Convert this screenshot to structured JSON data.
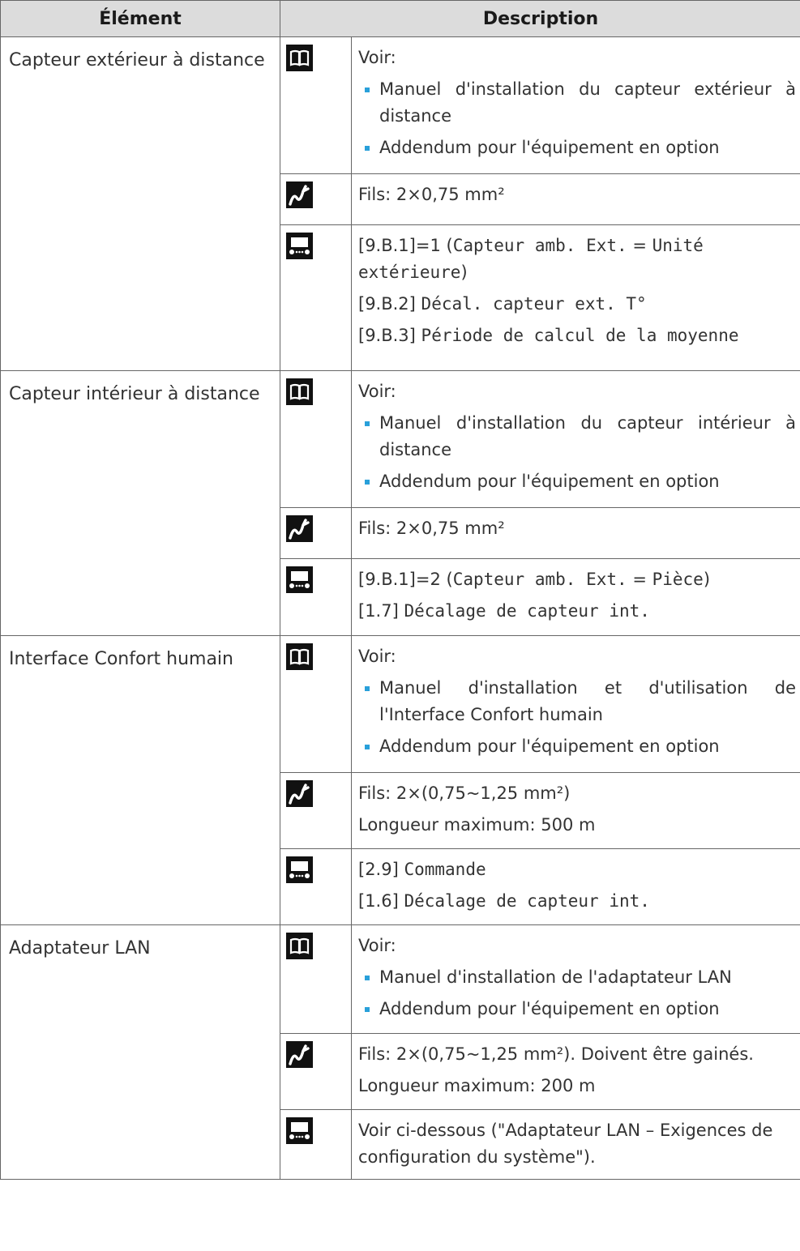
{
  "header": {
    "element": "Élément",
    "description": "Description"
  },
  "common": {
    "voir": "Voir:",
    "addendum": "Addendum pour l'équipement en option"
  },
  "rows": {
    "r1": {
      "element": "Capteur extérieur à distance",
      "manual": "Manuel d'installation du capteur extérieur à distance",
      "wires": "Fils: 2×0,75 mm²",
      "s1_pre": "[9.B.1]=1 (",
      "s1_mono1": "Capteur amb. Ext.",
      "s1_eq": " = ",
      "s1_mono2": "Unité extérieure",
      "s1_post": ")",
      "s2_pre": "[9.B.2] ",
      "s2_mono": "Décal. capteur ext. T°",
      "s3_pre": "[9.B.3] ",
      "s3_mono": "Période de calcul de la moyenne"
    },
    "r2": {
      "element": "Capteur intérieur à distance",
      "manual": "Manuel d'installation du capteur intérieur à distance",
      "wires": "Fils: 2×0,75 mm²",
      "s1_pre": "[9.B.1]=2 (",
      "s1_mono1": "Capteur amb. Ext.",
      "s1_eq": " = ",
      "s1_mono2": "Pièce",
      "s1_post": ")",
      "s2_pre": "[1.7] ",
      "s2_mono": "Décalage de capteur int."
    },
    "r3": {
      "element": "Interface Confort humain",
      "manual": "Manuel d'installation et d'utilisation de l'Interface Confort humain",
      "wires": "Fils: 2×(0,75~1,25 mm²)",
      "length": "Longueur maximum: 500 m",
      "s1_pre": "[2.9] ",
      "s1_mono": "Commande",
      "s2_pre": "[1.6] ",
      "s2_mono": "Décalage de capteur int."
    },
    "r4": {
      "element": "Adaptateur LAN",
      "manual": "Manuel d'installation de l'adaptateur LAN",
      "wires": "Fils: 2×(0,75~1,25 mm²). Doivent être gainés.",
      "length": "Longueur maximum: 200 m",
      "settings": "Voir ci-dessous (\"Adaptateur LAN – Exigences de configuration du système\")."
    }
  },
  "icons": {
    "manual": "book-icon",
    "wiring": "wire-icon",
    "settings": "controller-icon"
  },
  "colors": {
    "bullet": "#29a0da",
    "header_bg": "#dcdcdc",
    "icon_bg": "#111111"
  }
}
